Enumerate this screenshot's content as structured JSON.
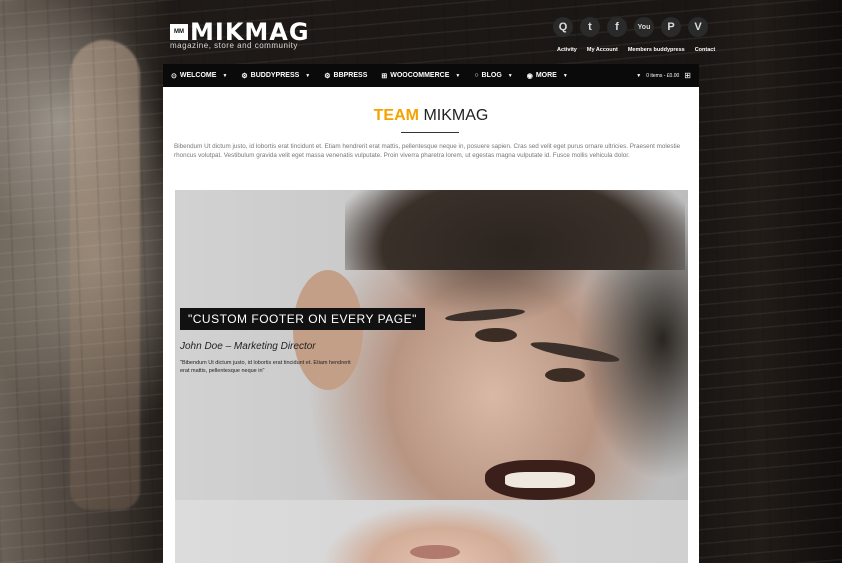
{
  "header": {
    "logo_badge": "MM",
    "logo_text": "MIKMAG",
    "tagline": "magazine, store and community",
    "social": [
      {
        "name": "search-icon",
        "glyph": "Q"
      },
      {
        "name": "twitter-icon",
        "glyph": "t"
      },
      {
        "name": "facebook-icon",
        "glyph": "f"
      },
      {
        "name": "youtube-icon",
        "glyph": "You"
      },
      {
        "name": "pinterest-icon",
        "glyph": "P"
      },
      {
        "name": "vimeo-icon",
        "glyph": "V"
      }
    ],
    "toplinks": [
      "Activity",
      "My Account",
      "Members buddypress",
      "Contact"
    ]
  },
  "nav": {
    "items": [
      {
        "icon": "⊙",
        "label": "WELCOME",
        "caret": "▼"
      },
      {
        "icon": "⚙",
        "label": "BUDDYPRESS",
        "caret": "▼"
      },
      {
        "icon": "⚙",
        "label": "BBPRESS",
        "caret": ""
      },
      {
        "icon": "⊞",
        "label": "WOOCOMMERCE",
        "caret": "▼"
      },
      {
        "icon": "○",
        "label": "BLOG",
        "caret": "▼"
      },
      {
        "icon": "◉",
        "label": "MORE",
        "caret": "▼"
      }
    ],
    "cart_caret": "▼",
    "cart_text": "0 items - £0.00",
    "cart_icon": "⊞"
  },
  "main": {
    "title_accent": "TEAM",
    "title_rest": "MIKMAG",
    "intro": "Bibendum Ut dictum justo, id lobortis erat tincidunt et. Etiam hendrerit erat mattis, pellentesque neque in, posuere sapien. Cras sed velit eget purus ornare ultricies. Praesent molestie rhoncus volutpat. Vestibulum gravida velit eget massa venenatis vulputate. Proin viverra pharetra lorem, ut egestas magna vulputate id. Fusce mollis vehicula dolor.",
    "hero": {
      "banner": "\"CUSTOM FOOTER ON EVERY PAGE\"",
      "person": "John Doe – Marketing Director",
      "quote": "\"Bibendum Ut dictum justo, id lobortis erat tincidunt et. Etiam hendrerit erat mattis, pellentesque neque in\""
    }
  },
  "colors": {
    "accent": "#f5a300",
    "nav_bg": "#0a0a0a"
  }
}
